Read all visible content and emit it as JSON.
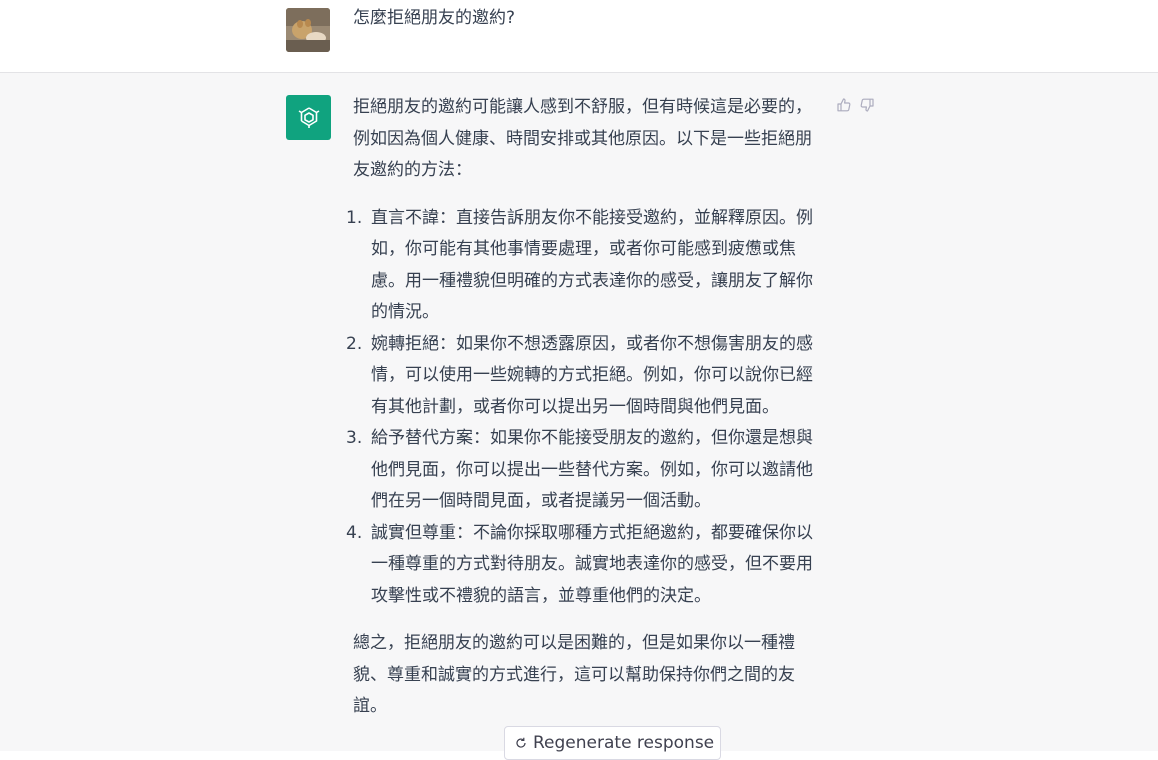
{
  "user_message": {
    "text": "怎麼拒絕朋友的邀約?"
  },
  "assistant_message": {
    "intro": "拒絕朋友的邀約可能讓人感到不舒服，但有時候這是必要的，例如因為個人健康、時間安排或其他原因。以下是一些拒絕朋友邀約的方法：",
    "items": [
      {
        "num": "1.",
        "text": "直言不諱：直接告訴朋友你不能接受邀約，並解釋原因。例如，你可能有其他事情要處理，或者你可能感到疲憊或焦慮。用一種禮貌但明確的方式表達你的感受，讓朋友了解你的情況。"
      },
      {
        "num": "2.",
        "text": "婉轉拒絕：如果你不想透露原因，或者你不想傷害朋友的感情，可以使用一些婉轉的方式拒絕。例如，你可以說你已經有其他計劃，或者你可以提出另一個時間與他們見面。"
      },
      {
        "num": "3.",
        "text": "給予替代方案：如果你不能接受朋友的邀約，但你還是想與他們見面，你可以提出一些替代方案。例如，你可以邀請他們在另一個時間見面，或者提議另一個活動。"
      },
      {
        "num": "4.",
        "text": "誠實但尊重：不論你採取哪種方式拒絕邀約，都要確保你以一種尊重的方式對待朋友。誠實地表達你的感受，但不要用攻擊性或不禮貌的語言，並尊重他們的決定。"
      }
    ],
    "conclusion": "總之，拒絕朋友的邀約可以是困難的，但是如果你以一種禮貌、尊重和誠實的方式進行，這可以幫助保持你們之間的友誼。"
  },
  "controls": {
    "regenerate_label": "Regenerate response"
  },
  "colors": {
    "bot_avatar_bg": "#10a37f",
    "assistant_bg": "#f7f7f8",
    "text": "#374151"
  }
}
